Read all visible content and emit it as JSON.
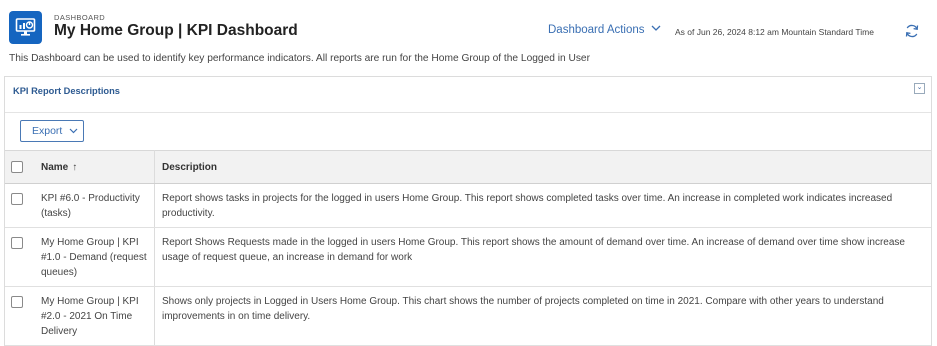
{
  "header": {
    "kicker": "DASHBOARD",
    "title": "My Home Group | KPI Dashboard",
    "actions_label": "Dashboard Actions",
    "as_of": "As of  Jun 26, 2024 8:12 am Mountain Standard Time"
  },
  "description": "This Dashboard can be used to identify key performance indicators. All reports are run for the Home Group of the Logged in User",
  "panel": {
    "title": "KPI Report Descriptions",
    "export_label": "Export",
    "columns": {
      "name": "Name",
      "sort_indicator": "↑",
      "description": "Description"
    },
    "rows": [
      {
        "name": "KPI #6.0 - Productivity (tasks)",
        "description": "Report shows tasks in projects for the logged in users Home Group. This report shows completed tasks over time. An increase in completed work indicates increased productivity."
      },
      {
        "name": "My Home Group | KPI #1.0 - Demand (request queues)",
        "description": "Report Shows Requests made in the logged in users Home Group. This report shows the amount of demand over time. An increase of demand over time show increase usage of request queue, an increase in demand for work"
      },
      {
        "name": "My Home Group | KPI #2.0 - 2021 On Time Delivery",
        "description": "Shows only projects in Logged in Users Home Group. This chart shows the number of projects completed on time in 2021. Compare with other years to understand improvements in on time delivery."
      }
    ]
  },
  "colors": {
    "brand": "#1565c0",
    "link": "#3a6fb3",
    "panel_title": "#2d5a91"
  }
}
